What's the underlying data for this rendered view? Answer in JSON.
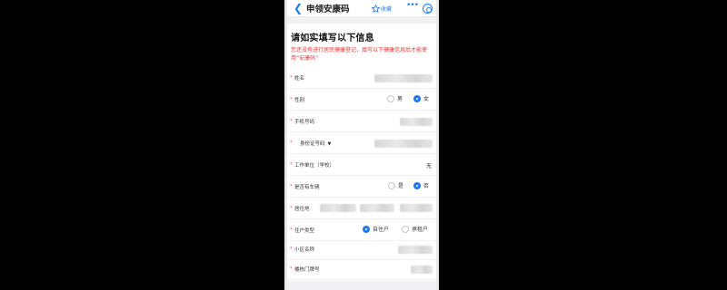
{
  "app": {
    "title": "申领安康码",
    "fav_label": "收藏"
  },
  "form": {
    "heading": "请如实填写以下信息",
    "notice": "您还没有进行居民健康登记，填写以下健康信息后才能使用“安康码”",
    "fields": {
      "name": {
        "label": "姓名"
      },
      "gender": {
        "label": "性别",
        "options": [
          "男",
          "女"
        ],
        "selected": "女"
      },
      "phone": {
        "label": "手机号码"
      },
      "id_type": {
        "label": "身份证号码",
        "caret": "▼"
      },
      "employer": {
        "label": "工作单位（学校）",
        "value": "无"
      },
      "vehicle": {
        "label": "是否有车辆",
        "options": [
          "是",
          "否"
        ],
        "selected": "否"
      },
      "address": {
        "label": "居住地"
      },
      "resident_type": {
        "label": "住户类型",
        "options": [
          "自住户",
          "承租户"
        ],
        "selected": "自住户"
      },
      "community": {
        "label": "小区名称"
      },
      "building": {
        "label": "楼栋门牌号"
      }
    },
    "required_mark": "*"
  },
  "colors": {
    "accent": "#1a7cf5",
    "warning": "#e53935"
  },
  "icons": [
    "back-icon",
    "star-icon",
    "more-icon",
    "close-icon",
    "chevron-down-icon"
  ]
}
